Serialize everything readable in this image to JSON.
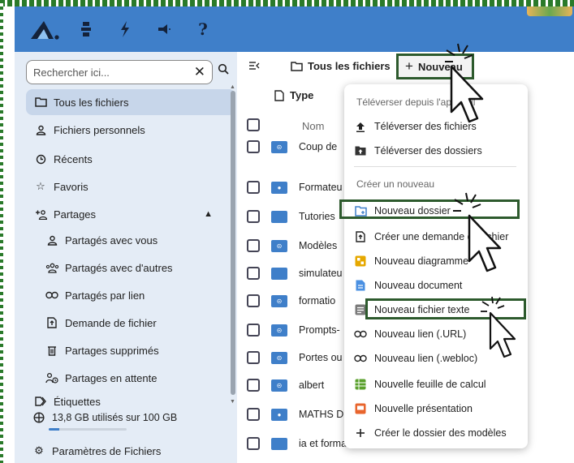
{
  "header": {
    "icons": [
      "app-logo-icon",
      "files-icon",
      "activity-icon",
      "announcements-icon",
      "help-icon"
    ]
  },
  "sidebar": {
    "search": {
      "placeholder": "Rechercher ici..."
    },
    "items": [
      {
        "label": "Tous les fichiers",
        "icon": "folder-icon",
        "active": true
      },
      {
        "label": "Fichiers personnels",
        "icon": "user-icon"
      },
      {
        "label": "Récents",
        "icon": "history-icon"
      },
      {
        "label": "Favoris",
        "icon": "star-icon"
      },
      {
        "label": "Partages",
        "icon": "share-icon"
      },
      {
        "label": "Partagés avec vous",
        "icon": "user-icon"
      },
      {
        "label": "Partagés avec d'autres",
        "icon": "group-icon"
      },
      {
        "label": "Partagés par lien",
        "icon": "link-icon"
      },
      {
        "label": "Demande de fichier",
        "icon": "file-request-icon"
      },
      {
        "label": "Partages supprimés",
        "icon": "trash-icon"
      },
      {
        "label": "Partages en attente",
        "icon": "pending-icon"
      },
      {
        "label": "Étiquettes",
        "icon": "tag-icon"
      }
    ],
    "storage": {
      "label": "13,8 GB utilisés sur 100 GB",
      "used_fraction": 0.138
    },
    "settings_label": "Paramètres de Fichiers"
  },
  "main": {
    "breadcrumb": "Tous les fichiers",
    "new_button": "Nouveau",
    "type_filter": "Type",
    "column_name": "Nom",
    "files": [
      {
        "name": "Coup de",
        "kind": "shared"
      },
      {
        "name": "Formateu",
        "kind": "user"
      },
      {
        "name": "Tutories",
        "kind": "folder"
      },
      {
        "name": "Modèles",
        "kind": "shared"
      },
      {
        "name": "simulateu",
        "kind": "folder"
      },
      {
        "name": "formatio",
        "kind": "shared"
      },
      {
        "name": "Prompts-",
        "kind": "shared"
      },
      {
        "name": "Portes ou",
        "kind": "shared"
      },
      {
        "name": "albert",
        "kind": "shared"
      },
      {
        "name": "MATHS D",
        "kind": "user"
      },
      {
        "name": "ia et formation",
        "kind": "folder"
      }
    ]
  },
  "dropdown": {
    "upload_section": "Téléverser depuis l'appareil",
    "upload_files": "Téléverser des fichiers",
    "upload_folders": "Téléverser des dossiers",
    "create_section": "Créer un nouveau",
    "items": [
      {
        "label": "Nouveau dossier",
        "icon": "new-folder-icon",
        "color": "#3f7fc9"
      },
      {
        "label": "Créer une demande de fichier",
        "icon": "file-request-icon",
        "color": "#222222"
      },
      {
        "label": "Nouveau diagramme",
        "icon": "diagram-icon",
        "color": "#e6a800"
      },
      {
        "label": "Nouveau document",
        "icon": "document-icon",
        "color": "#4a90e2"
      },
      {
        "label": "Nouveau fichier texte",
        "icon": "text-file-icon",
        "color": "#7a7a7a"
      },
      {
        "label": "Nouveau lien (.URL)",
        "icon": "link-icon",
        "color": "#222222"
      },
      {
        "label": "Nouveau lien (.webloc)",
        "icon": "link-icon",
        "color": "#222222"
      },
      {
        "label": "Nouvelle feuille de calcul",
        "icon": "spreadsheet-icon",
        "color": "#5aa02c"
      },
      {
        "label": "Nouvelle présentation",
        "icon": "presentation-icon",
        "color": "#e8652d"
      },
      {
        "label": "Créer le dossier des modèles",
        "icon": "plus-icon",
        "color": "#222222"
      }
    ]
  },
  "colors": {
    "header": "#3f7fc9",
    "sidebar": "#e4ecf6",
    "highlight": "#2d5a2d"
  }
}
